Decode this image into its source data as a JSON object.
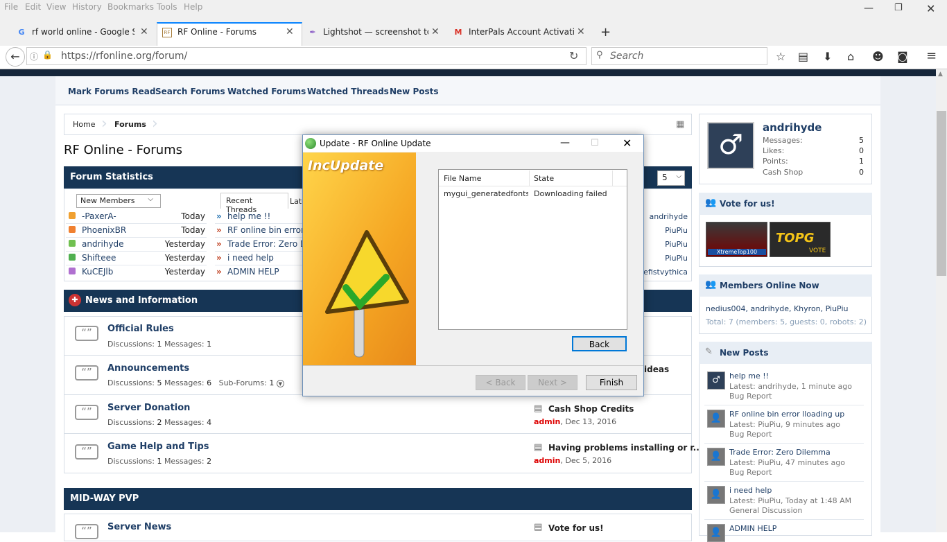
{
  "browser": {
    "menu": [
      "File",
      "Edit",
      "View",
      "History",
      "Bookmarks",
      "Tools",
      "Help"
    ],
    "tabs": [
      {
        "label": "rf world online - Google S...",
        "icon": "google-icon"
      },
      {
        "label": "RF Online - Forums",
        "icon": "forum-icon"
      },
      {
        "label": "Lightshot — screenshot to...",
        "icon": "feather-icon"
      },
      {
        "label": "InterPals Account Activati...",
        "icon": "gmail-icon"
      }
    ],
    "url": "https://rfonline.org/forum/",
    "search_placeholder": "Search"
  },
  "subnav": [
    "Mark Forums Read",
    "Search Forums",
    "Watched Forums",
    "Watched Threads",
    "New Posts"
  ],
  "breadcrumb": [
    "Home",
    "Forums"
  ],
  "page_title": "RF Online - Forums",
  "stats": {
    "title": "Forum Statistics",
    "select_value": "5",
    "members_select": "New Members",
    "members": [
      {
        "name": "-PaxerA-",
        "when": "Today",
        "color": "#f0a030"
      },
      {
        "name": "PhoenixBR",
        "when": "Today",
        "color": "#f08030"
      },
      {
        "name": "andrihyde",
        "when": "Yesterday",
        "color": "#70c050"
      },
      {
        "name": "Shifteee",
        "when": "Yesterday",
        "color": "#50b050"
      },
      {
        "name": "KuCEJlb",
        "when": "Yesterday",
        "color": "#b070d0"
      }
    ],
    "thread_tabs": [
      "Recent Threads",
      "Late"
    ],
    "threads": [
      "help me !!",
      "RF online bin error ll",
      "Trade Error: Zero D",
      "i need help",
      "ADMIN HELP"
    ],
    "thread_users": [
      "andrihyde",
      "PiuPiu",
      "PiuPiu",
      "PiuPiu",
      "irefistvythica"
    ]
  },
  "news": {
    "title": "News and Information",
    "forums": [
      {
        "title": "Official Rules",
        "disc_label": "Discussions:",
        "disc": "1",
        "msg_label": "Messages:",
        "msg": "1"
      },
      {
        "title": "Announcements",
        "disc_label": "Discussions:",
        "disc": "5",
        "msg_label": "Messages:",
        "msg": "6",
        "sub_label": "Sub-Forums:",
        "sub": "1",
        "last_title": "ideas"
      },
      {
        "title": "Server Donation",
        "disc_label": "Discussions:",
        "disc": "2",
        "msg_label": "Messages:",
        "msg": "4",
        "last_title": "Cash Shop Credits",
        "last_user": "admin",
        "last_date": ", Dec 13, 2016"
      },
      {
        "title": "Game Help and Tips",
        "disc_label": "Discussions:",
        "disc": "1",
        "msg_label": "Messages:",
        "msg": "2",
        "last_title": "Having problems installing or r...",
        "last_user": "admin",
        "last_date": ", Dec 5, 2016"
      }
    ]
  },
  "midway": {
    "title": "MID-WAY PVP",
    "forum_title": "Server News",
    "last_title": "Vote for us!"
  },
  "sidebar": {
    "user": {
      "name": "andrihyde",
      "stats": [
        {
          "label": "Messages:",
          "value": "5"
        },
        {
          "label": "Likes:",
          "value": "0"
        },
        {
          "label": "Points:",
          "value": "1"
        },
        {
          "label": "Cash Shop",
          "value": "0"
        }
      ]
    },
    "vote_title": "Vote for us!",
    "vote_banners": [
      "XtremeTop100",
      "TOPG",
      "VOTE"
    ],
    "online_title": "Members Online Now",
    "online_members": "nedius004, andrihyde, Khyron, PiuPiu",
    "online_total": "Total: 7 (members: 5, guests: 0, robots: 2)",
    "new_posts_title": "New Posts",
    "new_posts": [
      {
        "title": "help me !!",
        "latest": "Latest: andrihyde, 1 minute ago",
        "forum": "Bug Report"
      },
      {
        "title": "RF online bin error lloading up",
        "latest": "Latest: PiuPiu, 9 minutes ago",
        "forum": "Bug Report"
      },
      {
        "title": "Trade Error: Zero Dilemma",
        "latest": "Latest: PiuPiu, 47 minutes ago",
        "forum": "Bug Report"
      },
      {
        "title": "i need help",
        "latest": "Latest: PiuPiu, Today at 1:48 AM",
        "forum": "General Discussion"
      },
      {
        "title": "ADMIN HELP",
        "latest": "",
        "forum": ""
      }
    ]
  },
  "dialog": {
    "title": "Update - RF Online Update",
    "logo_text": "IncUpdate",
    "columns": [
      "File Name",
      "State"
    ],
    "file": "mygui_generatedfonts | ...",
    "state": "Downloading failed",
    "back": "Back",
    "prev": "< Back",
    "next": "Next >",
    "finish": "Finish"
  }
}
